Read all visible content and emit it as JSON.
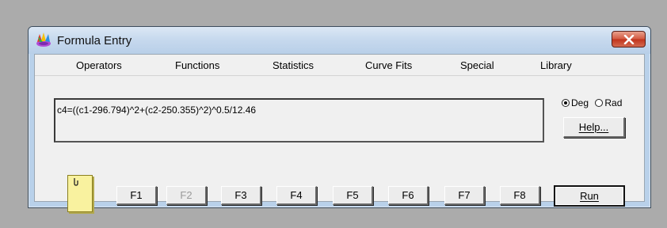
{
  "window": {
    "title": "Formula Entry",
    "icons": {
      "app": "palette-flower-icon",
      "close": "close-x-icon"
    }
  },
  "menu": {
    "items": [
      {
        "label": "Operators"
      },
      {
        "label": "Functions"
      },
      {
        "label": "Statistics"
      },
      {
        "label": "Curve Fits"
      },
      {
        "label": "Special"
      },
      {
        "label": "Library"
      }
    ]
  },
  "formula": {
    "value": "c4=((c1-296.794)^2+(c2-250.355)^2)^0.5/12.46"
  },
  "angle_mode": {
    "options": [
      {
        "label": "Deg",
        "checked": true
      },
      {
        "label": "Rad",
        "checked": false
      }
    ]
  },
  "buttons": {
    "help_label": "Help...",
    "run_label": "Run",
    "function_keys": [
      {
        "label": "F1",
        "enabled": true
      },
      {
        "label": "F2",
        "enabled": false
      },
      {
        "label": "F3",
        "enabled": true
      },
      {
        "label": "F4",
        "enabled": true
      },
      {
        "label": "F5",
        "enabled": true
      },
      {
        "label": "F6",
        "enabled": true
      },
      {
        "label": "F7",
        "enabled": true
      },
      {
        "label": "F8",
        "enabled": true
      }
    ]
  },
  "notes_icon": "sticky-note-icon",
  "colors": {
    "desktop": "#ababab",
    "frame": "#b9d1ea",
    "close_button": "#c7432c",
    "note": "#f9f29f"
  }
}
